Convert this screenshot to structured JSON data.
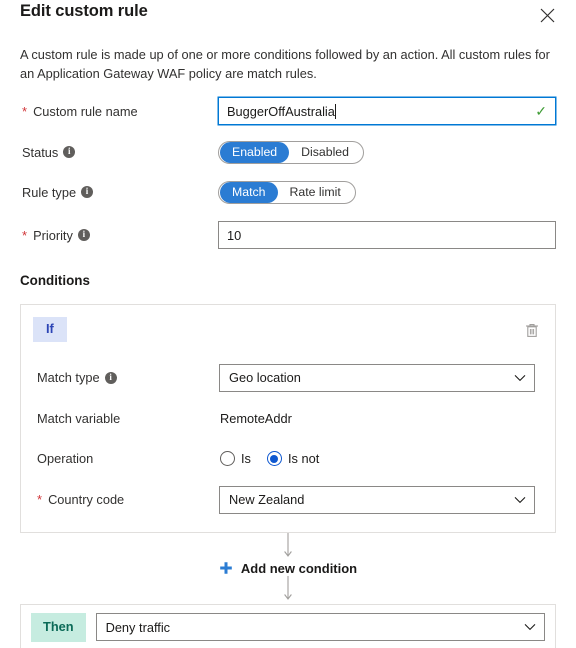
{
  "header": {
    "title": "Edit custom rule",
    "close_icon": "close-icon"
  },
  "description": "A custom rule is made up of one or more conditions followed by an action. All custom rules for an Application Gateway WAF policy are match rules.",
  "form": {
    "custom_rule_name": {
      "label": "Custom rule name",
      "required": true,
      "value": "BuggerOffAustralia",
      "valid_icon": "checkmark-icon",
      "focused": true
    },
    "status": {
      "label": "Status",
      "info_icon": "info-icon",
      "options": [
        "Enabled",
        "Disabled"
      ],
      "selected": "Enabled"
    },
    "rule_type": {
      "label": "Rule type",
      "info_icon": "info-icon",
      "options": [
        "Match",
        "Rate limit"
      ],
      "selected": "Match"
    },
    "priority": {
      "label": "Priority",
      "required": true,
      "info_icon": "info-icon",
      "value": "10"
    }
  },
  "conditions": {
    "heading": "Conditions",
    "card": {
      "badge": "If",
      "delete_icon": "trash-icon",
      "match_type": {
        "label": "Match type",
        "info_icon": "info-icon",
        "value": "Geo location",
        "chevron": "chevron-down-icon"
      },
      "match_variable": {
        "label": "Match variable",
        "value": "RemoteAddr"
      },
      "operation": {
        "label": "Operation",
        "options": [
          "Is",
          "Is not"
        ],
        "selected": "Is not"
      },
      "country_code": {
        "label": "Country code",
        "required": true,
        "value": "New Zealand",
        "chevron": "chevron-down-icon"
      }
    },
    "add_condition": {
      "label": "Add new condition",
      "icon": "plus-icon"
    }
  },
  "action": {
    "badge": "Then",
    "value": "Deny traffic",
    "chevron": "chevron-down-icon"
  },
  "colors": {
    "accent_blue": "#2b7cd3",
    "radio_blue": "#0f58d0",
    "if_badge_bg": "#dbe3f8",
    "if_badge_text": "#2b44b5",
    "then_badge_bg": "#c6ece0",
    "then_badge_text": "#0b6a57",
    "required_red": "#d13438",
    "valid_green": "#3f9c35",
    "focus_border": "#0078d4"
  }
}
